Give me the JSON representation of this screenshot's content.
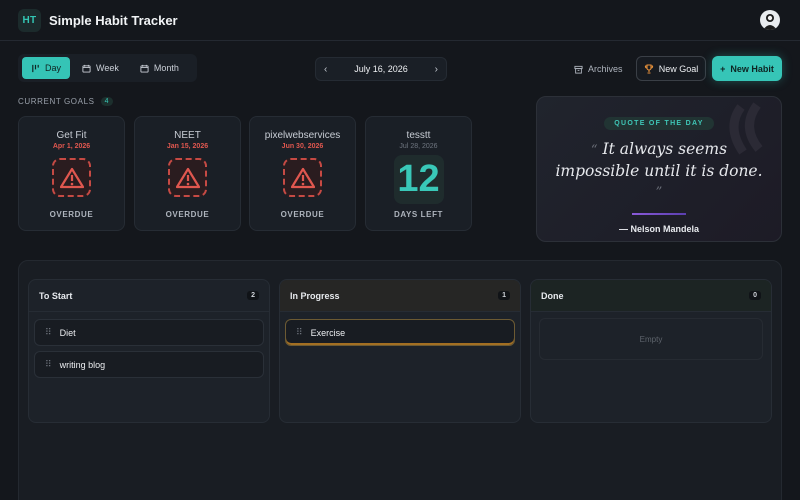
{
  "app": {
    "logo": "HT",
    "title": "Simple Habit Tracker"
  },
  "toolbar": {
    "views": [
      {
        "label": "Day",
        "icon": "day-icon",
        "active": true
      },
      {
        "label": "Week",
        "icon": "calendar-icon",
        "active": false
      },
      {
        "label": "Month",
        "icon": "calendar-icon",
        "active": false
      }
    ],
    "date": "July 16, 2026",
    "archives_label": "Archives",
    "new_goal_label": "New Goal",
    "new_habit_label": "New Habit"
  },
  "goals": {
    "label": "CURRENT GOALS",
    "count": "4",
    "items": [
      {
        "name": "Get Fit",
        "date": "Apr 1, 2026",
        "status": "OVERDUE"
      },
      {
        "name": "NEET",
        "date": "Jan 15, 2026",
        "status": "OVERDUE"
      },
      {
        "name": "pixelwebservices",
        "date": "Jun 30, 2026",
        "status": "OVERDUE"
      },
      {
        "name": "tesstt",
        "date": "Jul 28, 2026",
        "days": "12",
        "status": "DAYS LEFT"
      }
    ]
  },
  "quote": {
    "badge": "QUOTE OF THE DAY",
    "open": "“",
    "text": "It always seems impossible until it is done.",
    "close": "”",
    "author": "— Nelson Mandela"
  },
  "board": {
    "columns": [
      {
        "title": "To Start",
        "count": "2",
        "cards": [
          "Diet",
          "writing blog"
        ]
      },
      {
        "title": "In Progress",
        "count": "1",
        "cards": [
          "Exercise"
        ]
      },
      {
        "title": "Done",
        "count": "0",
        "empty": "Empty"
      }
    ]
  },
  "colors": {
    "accent": "#36c5b7",
    "danger": "#e0574f",
    "background": "#14171c"
  }
}
